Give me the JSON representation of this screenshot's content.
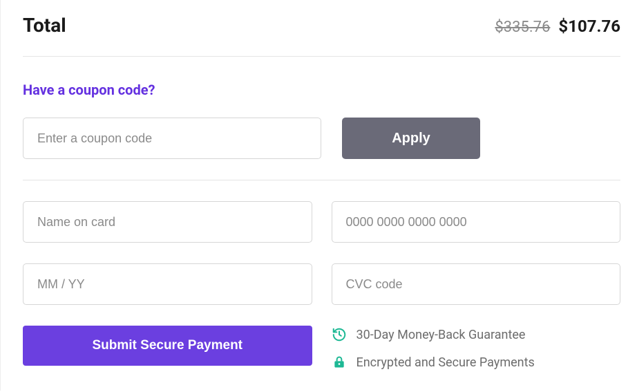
{
  "total": {
    "label": "Total",
    "original_price": "$335.76",
    "final_price": "$107.76"
  },
  "coupon": {
    "prompt": "Have a coupon code?",
    "placeholder": "Enter a coupon code",
    "apply_label": "Apply"
  },
  "payment": {
    "name_placeholder": "Name on card",
    "card_placeholder": "0000 0000 0000 0000",
    "expiry_placeholder": "MM / YY",
    "cvc_placeholder": "CVC code",
    "submit_label": "Submit Secure Payment"
  },
  "guarantees": {
    "money_back": "30-Day Money-Back Guarantee",
    "secure": "Encrypted and Secure Payments"
  }
}
